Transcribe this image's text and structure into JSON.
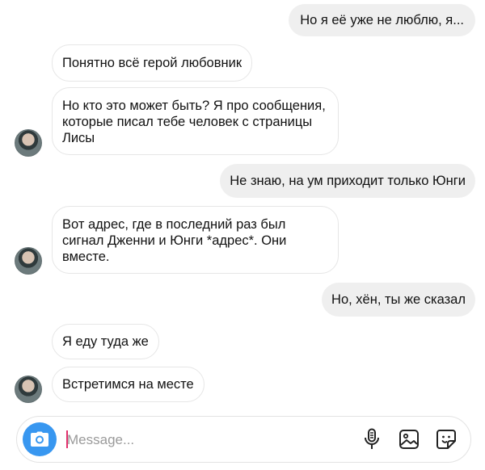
{
  "messages": [
    {
      "side": "out",
      "text": "Но я её уже не люблю, я..."
    },
    {
      "side": "in",
      "text": "Понятно всё герой любовник"
    },
    {
      "side": "in",
      "text": "Но кто это может быть?  Я про сообщения, которые писал тебе человек с страницы Лисы"
    },
    {
      "side": "out",
      "text": "Не знаю, на ум приходит только Юнги"
    },
    {
      "side": "in",
      "text": "Вот адрес, где в последний раз был сигнал Дженни и Юнги *адрес*. Они вместе."
    },
    {
      "side": "out",
      "text": "Но, хён, ты же сказал"
    },
    {
      "side": "in",
      "text": "Я еду туда же"
    },
    {
      "side": "in",
      "text": "Встретимся на месте"
    }
  ],
  "composer": {
    "placeholder": "Message...",
    "value": ""
  },
  "icons": {
    "camera": "camera-icon",
    "microphone": "microphone-icon",
    "gallery": "image-icon",
    "sticker": "sticker-icon"
  },
  "colors": {
    "accent": "#3897f0",
    "caret": "#e1306c",
    "outgoing_bubble": "#efefef",
    "incoming_border": "#e6e6e6"
  }
}
